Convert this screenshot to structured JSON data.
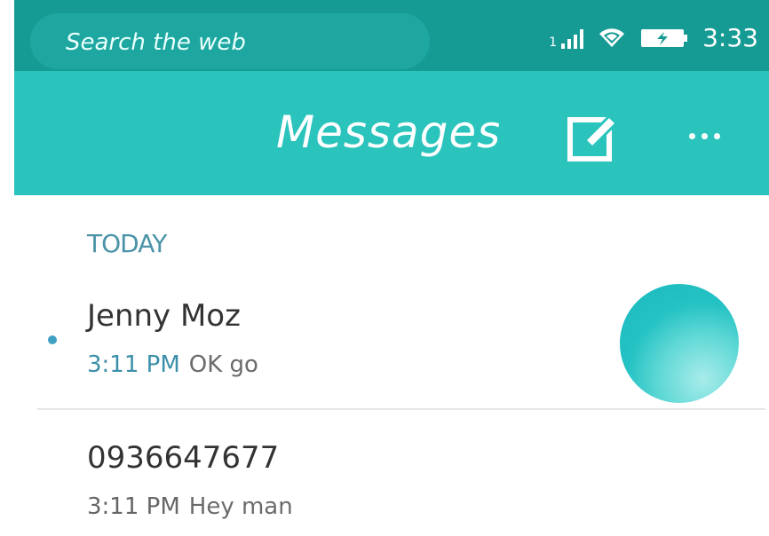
{
  "status_bar": {
    "search_placeholder": "Search the web",
    "signal_label": "1",
    "time": "3:33"
  },
  "header": {
    "title": "Messages"
  },
  "list": {
    "section_label": "TODAY",
    "threads": [
      {
        "name": "Jenny Moz",
        "time": "3:11 PM",
        "preview": "OK go",
        "unread": true
      },
      {
        "name": "0936647677",
        "time": "3:11 PM",
        "preview": "Hey man",
        "unread": false
      }
    ]
  },
  "colors": {
    "status_bar": "#169a94",
    "header": "#2ac4bd",
    "accent": "#3c8faa"
  },
  "icons": [
    "signal-icon",
    "wifi-icon",
    "battery-charging-icon",
    "compose-icon",
    "more-options-icon"
  ]
}
